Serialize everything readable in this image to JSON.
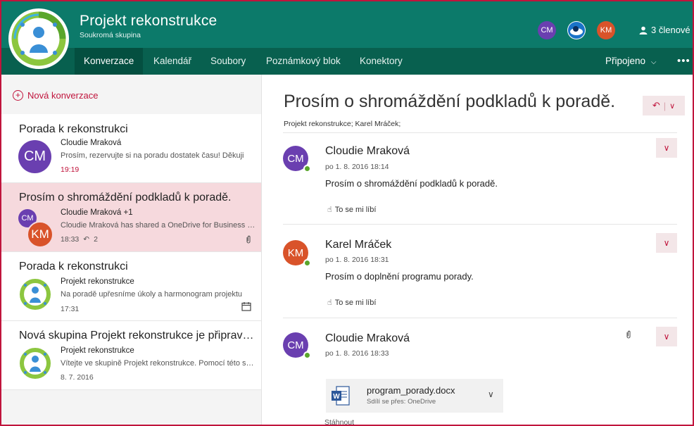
{
  "header": {
    "title": "Projekt rekonstrukce",
    "subtitle": "Soukromá skupina",
    "members_label": "3 členové",
    "avatars": [
      {
        "initials": "CM",
        "color": "#6a3fb0"
      },
      {
        "initials": "",
        "color": "#1a73c8"
      },
      {
        "initials": "KM",
        "color": "#d9532a"
      }
    ]
  },
  "nav": {
    "tabs": [
      "Konverzace",
      "Kalendář",
      "Soubory",
      "Poznámkový blok",
      "Konektory"
    ],
    "active": "Konverzace",
    "connected": "Připojeno",
    "more": "•••"
  },
  "left": {
    "new_conversation": "Nová konverzace",
    "items": [
      {
        "title": "Porada k rekonstrukci",
        "sender": "Cloudie Mraková",
        "preview": "Prosím, rezervujte si na poradu dostatek času! Děkuji",
        "time": "19:19",
        "avatar": "CM"
      },
      {
        "title": "Prosím o shromáždění podkladů k poradě.",
        "sender": "Cloudie Mraková +1",
        "preview": "Cloudie Mraková has shared a OneDrive for Business file with you. To view it, click the link below.",
        "time": "18:33",
        "reply_count": "2",
        "avatar_back": "CM",
        "avatar_front": "KM"
      },
      {
        "title": "Porada k rekonstrukci",
        "sender": "Projekt rekonstrukce",
        "preview": "Na poradě upřesníme úkoly a harmonogram projektu",
        "time": "17:31"
      },
      {
        "title": "Nová skupina Projekt rekonstrukce je připravena",
        "sender": "Projekt rekonstrukce",
        "preview": "Vítejte ve skupině Projekt rekonstrukce. Pomocí této skupiny",
        "time": "8. 7. 2016"
      }
    ]
  },
  "thread": {
    "subject": "Prosím o shromáždění podkladů k poradě.",
    "recipients": "Projekt rekonstrukce; Karel Mráček;",
    "messages": [
      {
        "initials": "CM",
        "name": "Cloudie Mraková",
        "date": "po 1. 8. 2016 18:14",
        "body": "Prosím o shromáždění podkladů k poradě.",
        "like": "To se mi líbí"
      },
      {
        "initials": "KM",
        "name": "Karel Mráček",
        "date": "po 1. 8. 2016 18:31",
        "body": "Prosím o doplnění programu porady.",
        "like": "To se mi líbí"
      },
      {
        "initials": "CM",
        "name": "Cloudie Mraková",
        "date": "po 1. 8. 2016 18:33"
      }
    ],
    "attachment": {
      "name": "program_porady.docx",
      "sub": "Sdílí se přes: OneDrive",
      "download": "Stáhnout"
    }
  },
  "colors": {
    "accent": "#c0143c",
    "header": "#0c7a6a",
    "nav": "#08604f",
    "cm": "#6a3fb0",
    "km": "#d9532a",
    "online": "#5aa62c"
  }
}
